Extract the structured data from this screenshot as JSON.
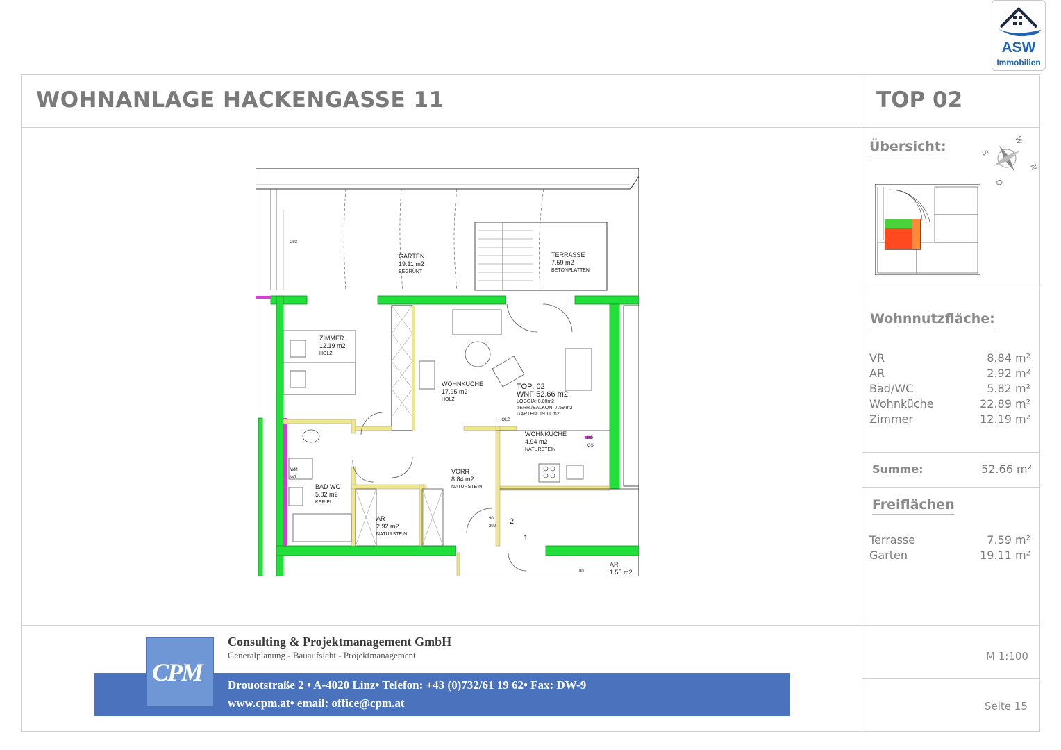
{
  "header": {
    "title": "WOHNANLAGE HACKENGASSE 11",
    "top": "TOP 02"
  },
  "logo": {
    "name": "ASW",
    "sub": "Immobilien"
  },
  "overview": {
    "heading": "Übersicht:"
  },
  "wohnnutzflaeche": {
    "heading": "Wohnnutzfläche:",
    "rows": [
      {
        "label": "VR",
        "value": "8.84 m²"
      },
      {
        "label": "AR",
        "value": "2.92 m²"
      },
      {
        "label": "Bad/WC",
        "value": "5.82 m²"
      },
      {
        "label": "Wohnküche",
        "value": "22.89 m²"
      },
      {
        "label": "Zimmer",
        "value": "12.19 m²"
      }
    ],
    "sum_label": "Summe:",
    "sum_value": "52.66 m²"
  },
  "freiflaechen": {
    "heading": "Freiflächen",
    "rows": [
      {
        "label": "Terrasse",
        "value": "7.59 m²"
      },
      {
        "label": "Garten",
        "value": "19.11 m²"
      }
    ]
  },
  "scale": "M 1:100",
  "page": "Seite 15",
  "company": {
    "name": "Consulting & Projektmanagement GmbH",
    "tagline": "Generalplanung - Bauaufsicht - Projektmanagement",
    "address": "Drouotstraße 2 • A-4020 Linz• Telefon: +43 (0)732/61 19 62• Fax: DW-9",
    "web": "www.cpm.at•  email: office@cpm.at",
    "logo_text": "CPM"
  },
  "plan": {
    "garten": {
      "name": "GARTEN",
      "area": "19.11 m2",
      "finish": "BEGRÜNT"
    },
    "terrasse": {
      "name": "TERRASSE",
      "area": "7.59 m2",
      "finish": "BETONPLATTEN"
    },
    "zimmer": {
      "name": "ZIMMER",
      "area": "12.19 m2",
      "finish": "HOLZ"
    },
    "wohnkueche": {
      "name": "WOHNKÜCHE",
      "area": "17.95 m2",
      "finish": "HOLZ"
    },
    "kueche": {
      "name": "WOHNKÜCHE",
      "area": "4.94 m2",
      "finish": "NATURSTEIN"
    },
    "vorr": {
      "name": "VORR",
      "area": "8.84 m2",
      "finish": "NATURSTEIN"
    },
    "bad": {
      "name": "BAD WC",
      "area": "5.82 m2",
      "finish": "KER.PL."
    },
    "ar": {
      "name": "AR",
      "area": "2.92 m2",
      "finish": "NATURSTEIN"
    },
    "ar2": {
      "name": "AR",
      "area": "1.55 m2"
    },
    "top_info": {
      "top": "TOP: 02",
      "wnf": "WNF:52.66 m2",
      "loggia": "LOGGIA:  0.00m2",
      "terr": "TERR./BALKON:  7.59 m2",
      "garten": "GARTEN:  19.11 m2"
    },
    "holz": "HOLZ",
    "door_80_200": "80\n200",
    "num1": "1",
    "num2": "2",
    "dim293": "293",
    "wmwt": "WM\nWT",
    "ks": "KS\nGS",
    "d90": "90\n200",
    "d80": "80"
  },
  "colors": {
    "wall_green": "#22e03a",
    "wall_magenta": "#d83bd8",
    "wall_yellow": "#f0e68c",
    "overview_orange": "#ff4a1f",
    "overview_green": "#4ad23c",
    "cpm_blue": "#4b73bd"
  }
}
